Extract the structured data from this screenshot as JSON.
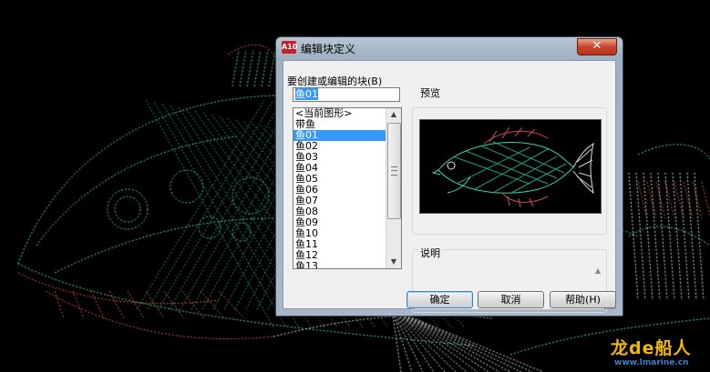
{
  "window": {
    "title": "编辑块定义",
    "icon_label": "A10",
    "close_icon": "close-icon"
  },
  "block": {
    "label": "要创建或编辑的块(B)",
    "name_value": "鱼01",
    "list_items": [
      "<当前图形>",
      "带鱼",
      "鱼01",
      "鱼02",
      "鱼03",
      "鱼04",
      "鱼05",
      "鱼06",
      "鱼07",
      "鱼08",
      "鱼09",
      "鱼10",
      "鱼11",
      "鱼12",
      "鱼13"
    ],
    "selected_item": "鱼01"
  },
  "preview": {
    "label": "预览"
  },
  "description": {
    "label": "说明"
  },
  "buttons": {
    "ok": "确定",
    "cancel": "取消",
    "help": "帮助(H)"
  },
  "watermark": {
    "brand": "龙de船人",
    "url": "www.lmarine.cn"
  },
  "colors": {
    "selection": "#3399ff",
    "dialog_face": "#f0f0f0",
    "close_button": "#c8452b",
    "watermark": "#f2b700",
    "watermark_url": "#3f7fc8"
  }
}
